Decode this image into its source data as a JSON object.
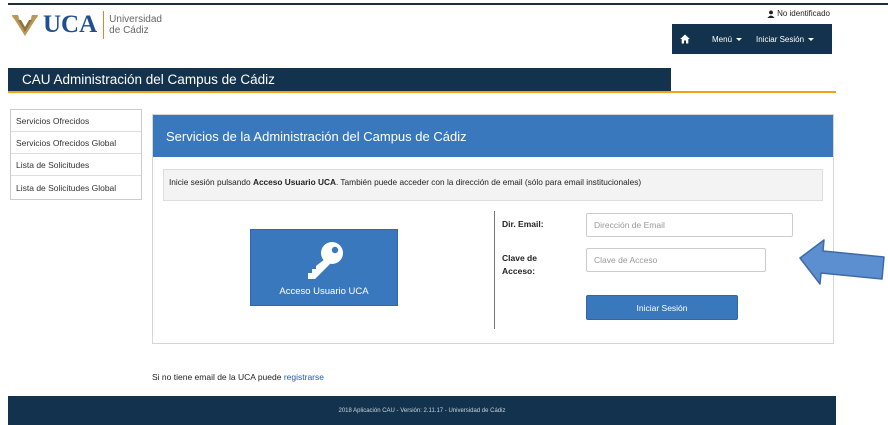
{
  "logo": {
    "text": "UCA",
    "line1": "Universidad",
    "line2": "de Cádiz"
  },
  "user_status": "No identificado",
  "navbar": {
    "menu_label": "Menú",
    "login_label": "Iniciar Sesión"
  },
  "title_bar": "CAU Administración del Campus de Cádiz",
  "sidebar": {
    "items": [
      {
        "label": "Servicios Ofrecidos"
      },
      {
        "label": "Servicios Ofrecidos Global"
      },
      {
        "label": "Lista de Solicitudes"
      },
      {
        "label": "Lista de Solicitudes Global"
      }
    ]
  },
  "panel": {
    "title": "Servicios de la Administración del Campus de Cádiz",
    "info_prefix": "Inicie sesión pulsando ",
    "info_bold": "Acceso Usuario UCA",
    "info_suffix": ". También puede acceder con la dirección de email (sólo para email institucionales)",
    "uca_button": "Acceso Usuario UCA",
    "email_label": "Dir. Email:",
    "email_placeholder": "Dirección de Email",
    "password_label_1": "Clave de",
    "password_label_2": "Acceso:",
    "password_placeholder": "Clave de Acceso",
    "submit_label": "Iniciar Sesión"
  },
  "register": {
    "prefix": "Si no tiene email de la UCA puede ",
    "link": "registrarse"
  },
  "footer": "2018 Aplicación CAU - Versión: 2.11.17 - Universidad de Cádiz",
  "colors": {
    "navy": "#13324d",
    "blue": "#3a78be",
    "orange": "#f2a11c"
  }
}
